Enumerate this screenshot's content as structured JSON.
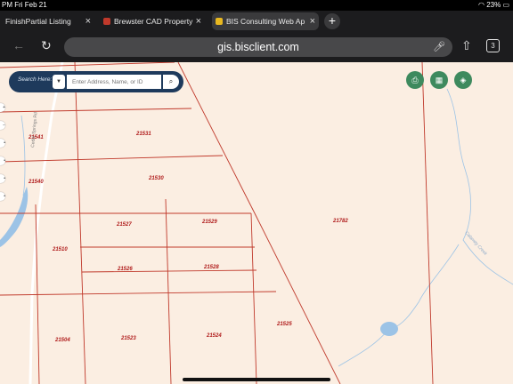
{
  "status_bar": {
    "left_text": "PM   Fri Feb 21",
    "battery": "23%"
  },
  "tabs": [
    {
      "label": "FinishPartial Listing",
      "favicon": "none",
      "active": false
    },
    {
      "label": "Brewster CAD Property",
      "favicon": "cad-icon",
      "active": false
    },
    {
      "label": "BIS Consulting Web Ap",
      "favicon": "bis-icon",
      "active": true
    }
  ],
  "toolbar": {
    "url": "gis.bisclient.com",
    "tab_count": "3"
  },
  "search": {
    "label": "Search Here:",
    "placeholder": "Enter Address, Name, or ID"
  },
  "map": {
    "road_label": "Cedar Springs Rd",
    "creek_label": "Calamity Creek",
    "parcels": [
      {
        "id": "21541"
      },
      {
        "id": "21531"
      },
      {
        "id": "21540"
      },
      {
        "id": "21530"
      },
      {
        "id": "21527"
      },
      {
        "id": "21529"
      },
      {
        "id": "21782"
      },
      {
        "id": "21510"
      },
      {
        "id": "21526"
      },
      {
        "id": "21528"
      },
      {
        "id": "21525"
      },
      {
        "id": "21504"
      },
      {
        "id": "21523"
      },
      {
        "id": "21524"
      }
    ],
    "colors": {
      "background": "#fbeee2",
      "parcel_line": "#c0392b",
      "parcel_label": "#b01c1c",
      "water": "#9cc3e6"
    }
  }
}
